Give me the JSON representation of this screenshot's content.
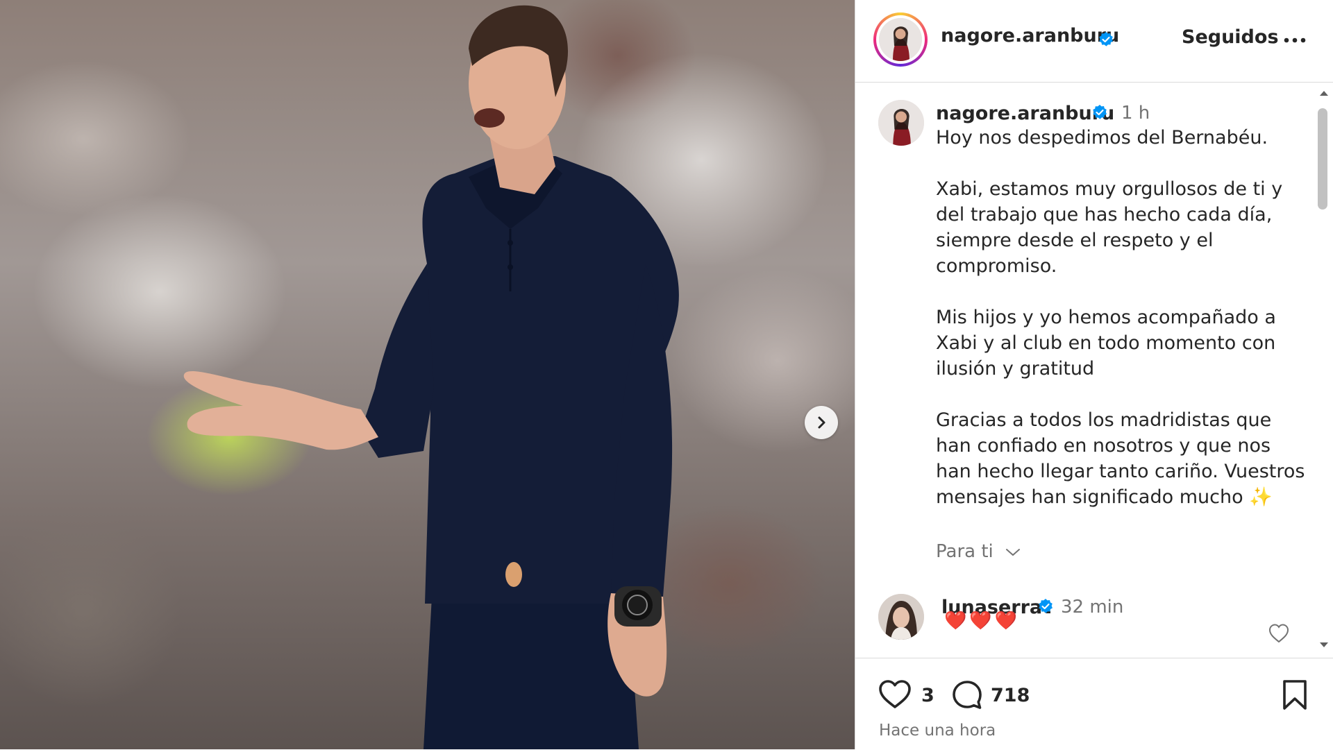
{
  "post": {
    "author": "nagore.aranburu",
    "follow_label": "Seguidos",
    "more_icon": "more-icon",
    "caption_time": "1 h",
    "caption_paragraphs": [
      "Hoy nos despedimos del Bernabéu.",
      "Xabi, estamos muy orgullosos de ti y del trabajo que has hecho cada día, siempre desde el respeto y el compromiso.",
      "Mis hijos y yo hemos acompañado a Xabi y al club en todo momento con ilusión y gratitud",
      "Gracias a todos los madridistas que han confiado en nosotros y que nos han hecho llegar tanto cariño. Vuestros mensajes han significado mucho ✨"
    ],
    "translate_label": "Para ti",
    "likes_count": "3",
    "comments_count": "718",
    "posted_time": "Hace una hora"
  },
  "comment": {
    "author": "lunaserrat",
    "time": "32 min",
    "text": "❤️❤️❤️"
  },
  "colors": {
    "verified": "#0095f6",
    "text": "#262626",
    "muted": "#737373",
    "heart_emoji": "#ff3040"
  },
  "icons": [
    "chevron-right-icon",
    "verified-badge-icon",
    "chevron-down-icon",
    "heart-icon",
    "comment-icon",
    "bookmark-icon",
    "more-icon"
  ]
}
